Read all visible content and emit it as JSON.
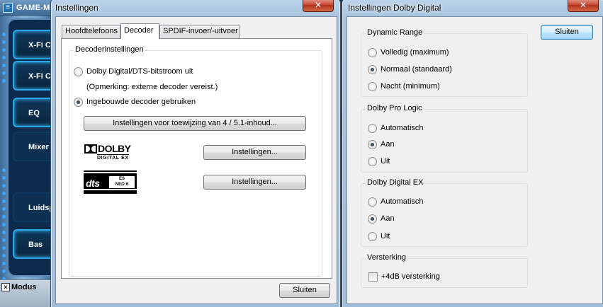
{
  "background_app": {
    "title": "GAME-M",
    "logo_glyph": "≡",
    "buttons": [
      "X-Fi C",
      "X-Fi C",
      "EQ",
      "Mixer",
      "Luidsp",
      "Bas"
    ],
    "footer_label": "Modus",
    "footer_icon": "✕"
  },
  "decoder_window": {
    "title": "Instellingen",
    "close_glyph": "✕",
    "tabs": [
      "Hoofdtelefoons",
      "Decoder",
      "SPDIF-invoer/-uitvoer"
    ],
    "selected_tab": "Decoder",
    "group_title": "Decoderinstellingen",
    "option_bitstream": "Dolby Digital/DTS-bitstroom uit",
    "note": "(Opmerking: externe decoder vereist.)",
    "option_builtin": "Ingebouwde decoder gebruiken",
    "mapping_button": "Instellingen voor toewijzing van 4 / 5.1-inhoud...",
    "dolby_button": "Instellingen...",
    "dts_button": "Instellingen...",
    "dolby_logo": {
      "word": "DOLBY",
      "sub": "DIGITAL EX"
    },
    "dts_logo": {
      "word": "dts",
      "sub1": "ES",
      "sub2": "NEO:6"
    },
    "close_button": "Sluiten"
  },
  "dolby_window": {
    "title": "Instellingen Dolby Digital",
    "close_glyph": "✕",
    "close_button": "Sluiten",
    "dynamic_range": {
      "title": "Dynamic Range",
      "options": [
        "Volledig (maximum)",
        "Normaal (standaard)",
        "Nacht (minimum)"
      ],
      "selected": 1
    },
    "pro_logic": {
      "title": "Dolby Pro Logic",
      "options": [
        "Automatisch",
        "Aan",
        "Uit"
      ],
      "selected": 1
    },
    "digital_ex": {
      "title": "Dolby Digital EX",
      "options": [
        "Automatisch",
        "Aan",
        "Uit"
      ],
      "selected": 1
    },
    "amplification": {
      "title": "Versterking",
      "checkbox_label": "+4dB versterking",
      "checked": false
    }
  }
}
